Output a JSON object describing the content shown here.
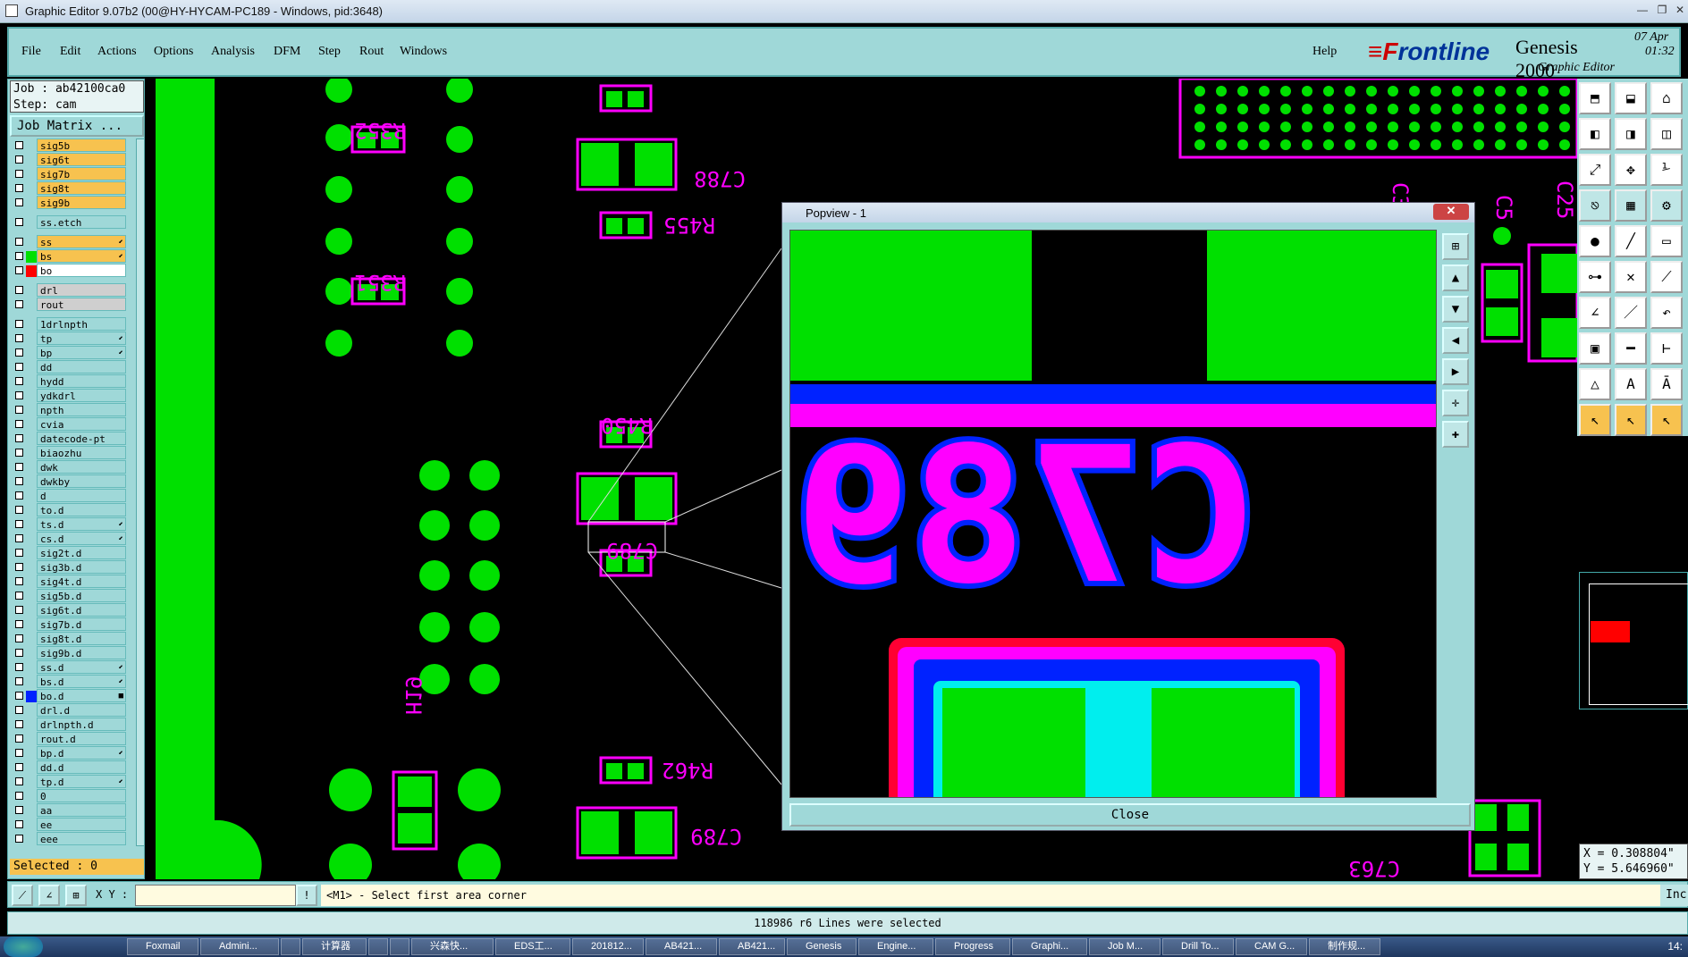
{
  "window": {
    "title": "Graphic Editor 9.07b2 (00@HY-HYCAM-PC189 - Windows, pid:3648)",
    "controls": [
      "—",
      "❐",
      "✕"
    ]
  },
  "menu": {
    "items": [
      {
        "label": "File"
      },
      {
        "label": "Edit"
      },
      {
        "label": "Actions"
      },
      {
        "label": "Options"
      },
      {
        "label": "Analysis"
      },
      {
        "label": "DFM"
      },
      {
        "label": "Step"
      },
      {
        "label": "Rout"
      },
      {
        "label": "Windows"
      }
    ],
    "help": "Help"
  },
  "brand": {
    "logo_prefix": "≡F",
    "logo_rest": "rontline",
    "product": "Genesis 2000",
    "subtitle": "Graphic Editor",
    "date": "07 Apr",
    "time": "01:32"
  },
  "job": {
    "job_line": "Job : ab42100ca0",
    "step_line": "Step: cam",
    "matrix_button": "Job Matrix ..."
  },
  "layers": [
    {
      "name": "sig5b",
      "bg": "#f7c24f",
      "swatch": "",
      "arrow": ""
    },
    {
      "name": "sig6t",
      "bg": "#f7c24f",
      "swatch": "",
      "arrow": ""
    },
    {
      "name": "sig7b",
      "bg": "#f7c24f",
      "swatch": "",
      "arrow": ""
    },
    {
      "name": "sig8t",
      "bg": "#f7c24f",
      "swatch": "",
      "arrow": ""
    },
    {
      "name": "sig9b",
      "bg": "#f7c24f",
      "swatch": "",
      "arrow": ""
    },
    {
      "name": "ss.etch",
      "bg": "#9fd8d8",
      "swatch": "",
      "arrow": "",
      "sep": true
    },
    {
      "name": "ss",
      "bg": "#f7c24f",
      "swatch": "",
      "arrow": "⬋",
      "sep": true
    },
    {
      "name": "bs",
      "bg": "#f7c24f",
      "swatch": "#00e000",
      "arrow": "⬋"
    },
    {
      "name": "bo",
      "bg": "#ffffff",
      "swatch": "#ff0000",
      "arrow": ""
    },
    {
      "name": "drl",
      "bg": "#cfcfcf",
      "swatch": "",
      "arrow": "",
      "sep": true
    },
    {
      "name": "rout",
      "bg": "#cfcfcf",
      "swatch": "",
      "arrow": ""
    },
    {
      "name": "1drlnpth",
      "bg": "#9fd8d8",
      "swatch": "",
      "arrow": "",
      "sep": true
    },
    {
      "name": "tp",
      "bg": "#9fd8d8",
      "swatch": "",
      "arrow": "⬋"
    },
    {
      "name": "bp",
      "bg": "#9fd8d8",
      "swatch": "",
      "arrow": "⬋"
    },
    {
      "name": "dd",
      "bg": "#9fd8d8",
      "swatch": "",
      "arrow": ""
    },
    {
      "name": "hydd",
      "bg": "#9fd8d8",
      "swatch": "",
      "arrow": ""
    },
    {
      "name": "ydkdrl",
      "bg": "#9fd8d8",
      "swatch": "",
      "arrow": ""
    },
    {
      "name": "npth",
      "bg": "#9fd8d8",
      "swatch": "",
      "arrow": ""
    },
    {
      "name": "cvia",
      "bg": "#9fd8d8",
      "swatch": "",
      "arrow": ""
    },
    {
      "name": "datecode-pt",
      "bg": "#9fd8d8",
      "swatch": "",
      "arrow": ""
    },
    {
      "name": "biaozhu",
      "bg": "#9fd8d8",
      "swatch": "",
      "arrow": ""
    },
    {
      "name": "dwk",
      "bg": "#9fd8d8",
      "swatch": "",
      "arrow": ""
    },
    {
      "name": "dwkby",
      "bg": "#9fd8d8",
      "swatch": "",
      "arrow": ""
    },
    {
      "name": "d",
      "bg": "#9fd8d8",
      "swatch": "",
      "arrow": ""
    },
    {
      "name": "to.d",
      "bg": "#9fd8d8",
      "swatch": "",
      "arrow": ""
    },
    {
      "name": "ts.d",
      "bg": "#9fd8d8",
      "swatch": "",
      "arrow": "⬋"
    },
    {
      "name": "cs.d",
      "bg": "#9fd8d8",
      "swatch": "",
      "arrow": "⬋"
    },
    {
      "name": "sig2t.d",
      "bg": "#9fd8d8",
      "swatch": "",
      "arrow": ""
    },
    {
      "name": "sig3b.d",
      "bg": "#9fd8d8",
      "swatch": "",
      "arrow": ""
    },
    {
      "name": "sig4t.d",
      "bg": "#9fd8d8",
      "swatch": "",
      "arrow": ""
    },
    {
      "name": "sig5b.d",
      "bg": "#9fd8d8",
      "swatch": "",
      "arrow": ""
    },
    {
      "name": "sig6t.d",
      "bg": "#9fd8d8",
      "swatch": "",
      "arrow": ""
    },
    {
      "name": "sig7b.d",
      "bg": "#9fd8d8",
      "swatch": "",
      "arrow": ""
    },
    {
      "name": "sig8t.d",
      "bg": "#9fd8d8",
      "swatch": "",
      "arrow": ""
    },
    {
      "name": "sig9b.d",
      "bg": "#9fd8d8",
      "swatch": "",
      "arrow": ""
    },
    {
      "name": "ss.d",
      "bg": "#9fd8d8",
      "swatch": "",
      "arrow": "⬋"
    },
    {
      "name": "bs.d",
      "bg": "#9fd8d8",
      "swatch": "",
      "arrow": "⬋"
    },
    {
      "name": "bo.d",
      "bg": "#9fd8d8",
      "swatch": "#0022ff",
      "arrow": "■"
    },
    {
      "name": "drl.d",
      "bg": "#9fd8d8",
      "swatch": "",
      "arrow": ""
    },
    {
      "name": "drlnpth.d",
      "bg": "#9fd8d8",
      "swatch": "",
      "arrow": ""
    },
    {
      "name": "rout.d",
      "bg": "#9fd8d8",
      "swatch": "",
      "arrow": ""
    },
    {
      "name": "bp.d",
      "bg": "#9fd8d8",
      "swatch": "",
      "arrow": "⬋"
    },
    {
      "name": "dd.d",
      "bg": "#9fd8d8",
      "swatch": "",
      "arrow": ""
    },
    {
      "name": "tp.d",
      "bg": "#9fd8d8",
      "swatch": "",
      "arrow": "⬋"
    },
    {
      "name": "0",
      "bg": "#9fd8d8",
      "swatch": "",
      "arrow": ""
    },
    {
      "name": "aa",
      "bg": "#9fd8d8",
      "swatch": "",
      "arrow": ""
    },
    {
      "name": "ee",
      "bg": "#9fd8d8",
      "swatch": "",
      "arrow": ""
    },
    {
      "name": "eee",
      "bg": "#9fd8d8",
      "swatch": "",
      "arrow": ""
    }
  ],
  "selected_count": "Selected : 0",
  "canvas_labels": [
    {
      "text": "R352"
    },
    {
      "text": "C788"
    },
    {
      "text": "R455"
    },
    {
      "text": "R351"
    },
    {
      "text": "R450"
    },
    {
      "text": "C789"
    },
    {
      "text": "R462"
    },
    {
      "text": "C789"
    },
    {
      "text": "H19"
    },
    {
      "text": "C763"
    },
    {
      "text": "C5"
    },
    {
      "text": "C3"
    },
    {
      "text": "C25"
    }
  ],
  "popview": {
    "title": "Popview - 1",
    "close_x": "✕",
    "close_button": "Close",
    "mirrored_text": "C789"
  },
  "coords": {
    "x": "X = 0.308804\"",
    "y": "Y = 5.646960\""
  },
  "command": {
    "xy_label": "X Y :",
    "xy_value": "",
    "prompt": "<M1> - Select first area corner",
    "units": "Inc"
  },
  "status": "118986 r6 Lines were selected",
  "taskbar": {
    "items": [
      "Foxmail",
      "Admini...",
      "",
      "计算器",
      "",
      "",
      "兴森快...",
      "EDS工...",
      "201812...",
      "AB421...",
      "AB421...",
      "Genesis",
      "Engine...",
      "Progress",
      "Graphi...",
      "Job M...",
      "Drill To...",
      "CAM G...",
      "制作规..."
    ],
    "clock": "14:"
  },
  "colors": {
    "panel": "#9fd8d8",
    "pad": "#00e000",
    "outline": "#ff00ff",
    "board": "#000000",
    "highlight": "#f7c24f"
  }
}
